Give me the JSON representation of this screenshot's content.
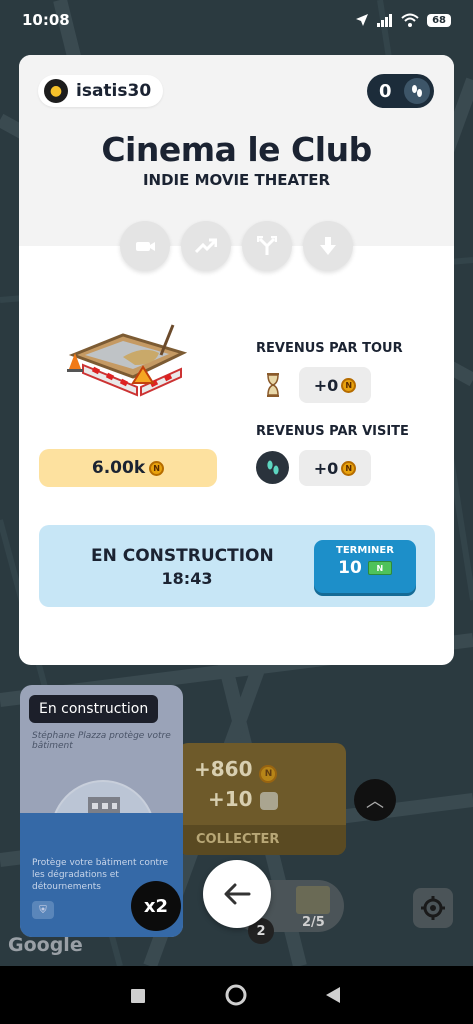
{
  "status_bar": {
    "time": "10:08",
    "battery": "68"
  },
  "header": {
    "username": "isatis30",
    "visits_count": "0",
    "building_name": "Cinema le Club",
    "building_type": "INDIE MOVIE THEATER"
  },
  "actions": [
    {
      "icon": "camera-icon"
    },
    {
      "icon": "trend-up-icon"
    },
    {
      "icon": "split-arrows-icon"
    },
    {
      "icon": "arrow-down-icon"
    }
  ],
  "price": {
    "value": "6.00k",
    "coin": "N"
  },
  "revenue": {
    "per_turn_label": "REVENUS PAR TOUR",
    "per_turn_value": "+0",
    "per_visit_label": "REVENUS PAR VISITE",
    "per_visit_value": "+0"
  },
  "construction": {
    "title": "EN CONSTRUCTION",
    "time_left": "18:43",
    "finish_label": "TERMINER",
    "finish_price": "10"
  },
  "background_card": {
    "coins": "+860",
    "dice": "+10",
    "collect_label": "COLLECTER"
  },
  "left_panel": {
    "tag": "En construction",
    "small_text": "Stéphane Plazza protège votre bâtiment",
    "description": "Protège votre bâtiment contre les dégradations et détournements",
    "multiplier": "x2"
  },
  "dock": {
    "badge": "2",
    "count": "2/5"
  },
  "map_attribution": "Google",
  "colors": {
    "accent": "#1d8fc9",
    "construction_bg": "#c7e6f6",
    "price_bg": "#fde19f",
    "dark": "#1b2332"
  }
}
